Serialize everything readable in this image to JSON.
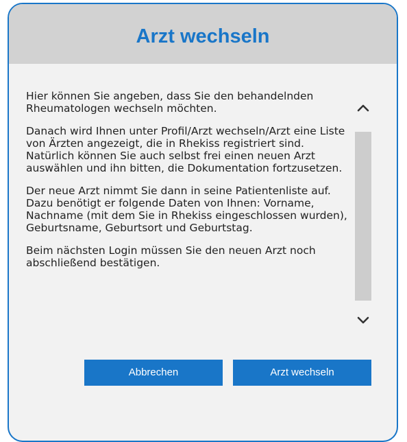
{
  "dialog": {
    "title": "Arzt wechseln",
    "paragraphs": [
      "Hier können Sie angeben, dass Sie den behandelnden Rheumatologen wechseln möchten.",
      "Danach wird Ihnen unter Profil/Arzt wechseln/Arzt eine Liste von Ärzten angezeigt, die in Rhekiss registriert sind. Natürlich können Sie auch selbst frei einen neuen Arzt auswählen und ihn bitten, die Dokumentation fortzusetzen.",
      "Der neue Arzt nimmt Sie dann in seine Patientenliste auf. Dazu benötigt er folgende Daten von Ihnen: Vorname, Nachname (mit dem Sie in Rhekiss eingeschlossen wurden), Geburtsname, Geburtsort und Geburtstag.",
      "Beim nächsten Login müssen Sie den neuen Arzt noch abschließend bestätigen."
    ],
    "buttons": {
      "cancel_label": "Abbrechen",
      "confirm_label": "Arzt wechseln"
    }
  },
  "colors": {
    "accent": "#1976c8",
    "header_bg": "#d2d2d2",
    "body_bg": "#f2f2f2",
    "scroll_track": "#cdcdcd"
  },
  "icons": {
    "scroll_up": "chevron-up-icon",
    "scroll_down": "chevron-down-icon"
  }
}
